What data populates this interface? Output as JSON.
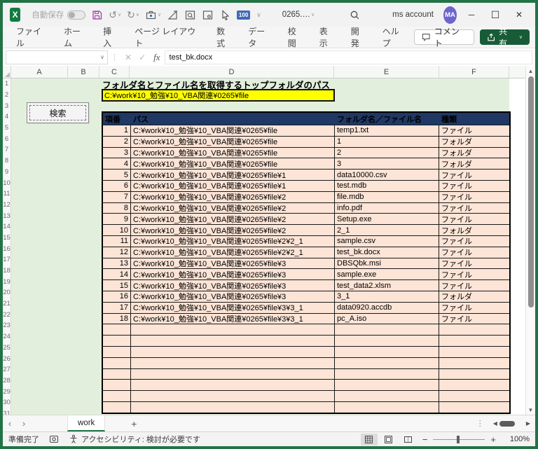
{
  "titlebar": {
    "autosave_label": "自動保存",
    "doc_title": "0265.…",
    "account_label": "ms account",
    "avatar_initials": "MA",
    "hundred_badge": "100"
  },
  "ribbon": {
    "tabs": [
      "ファイル",
      "ホーム",
      "挿入",
      "ページ レイアウト",
      "数式",
      "データ",
      "校閲",
      "表示",
      "開発",
      "ヘルプ"
    ],
    "comment_label": "コメント",
    "share_label": "共有"
  },
  "formula_bar": {
    "name_box": "",
    "fx_label": "fx",
    "content": "test_bk.docx"
  },
  "sheet": {
    "col_headers": [
      "A",
      "B",
      "C",
      "D",
      "E",
      "F"
    ],
    "row_count": 31,
    "title_c1": "フォルダ名とファイル名を取得するトップフォルダのパス",
    "top_folder_path": "C:¥work¥10_勉強¥10_VBA関連¥0265¥file",
    "search_button": "検索",
    "bg_color": "#E2EFDC",
    "highlight_color": "#FFFF00",
    "table": {
      "header_bg": "#1F3864",
      "row_bg": "#FCE4D6",
      "headers": [
        "項番",
        "パス",
        "フォルダ名／ファイル名",
        "種類"
      ],
      "empty_row_count": 8,
      "rows": [
        [
          "1",
          "C:¥work¥10_勉強¥10_VBA関連¥0265¥file",
          "temp1.txt",
          "ファイル"
        ],
        [
          "2",
          "C:¥work¥10_勉強¥10_VBA関連¥0265¥file",
          "1",
          "フォルダ"
        ],
        [
          "3",
          "C:¥work¥10_勉強¥10_VBA関連¥0265¥file",
          "2",
          "フォルダ"
        ],
        [
          "4",
          "C:¥work¥10_勉強¥10_VBA関連¥0265¥file",
          "3",
          "フォルダ"
        ],
        [
          "5",
          "C:¥work¥10_勉強¥10_VBA関連¥0265¥file¥1",
          "data10000.csv",
          "ファイル"
        ],
        [
          "6",
          "C:¥work¥10_勉強¥10_VBA関連¥0265¥file¥1",
          "test.mdb",
          "ファイル"
        ],
        [
          "7",
          "C:¥work¥10_勉強¥10_VBA関連¥0265¥file¥2",
          "file.mdb",
          "ファイル"
        ],
        [
          "8",
          "C:¥work¥10_勉強¥10_VBA関連¥0265¥file¥2",
          "info.pdf",
          "ファイル"
        ],
        [
          "9",
          "C:¥work¥10_勉強¥10_VBA関連¥0265¥file¥2",
          "Setup.exe",
          "ファイル"
        ],
        [
          "10",
          "C:¥work¥10_勉強¥10_VBA関連¥0265¥file¥2",
          "2_1",
          "フォルダ"
        ],
        [
          "11",
          "C:¥work¥10_勉強¥10_VBA関連¥0265¥file¥2¥2_1",
          "sample.csv",
          "ファイル"
        ],
        [
          "12",
          "C:¥work¥10_勉強¥10_VBA関連¥0265¥file¥2¥2_1",
          "test_bk.docx",
          "ファイル"
        ],
        [
          "13",
          "C:¥work¥10_勉強¥10_VBA関連¥0265¥file¥3",
          "DBSQbk.msi",
          "ファイル"
        ],
        [
          "14",
          "C:¥work¥10_勉強¥10_VBA関連¥0265¥file¥3",
          "sample.exe",
          "ファイル"
        ],
        [
          "15",
          "C:¥work¥10_勉強¥10_VBA関連¥0265¥file¥3",
          "test_data2.xlsm",
          "ファイル"
        ],
        [
          "16",
          "C:¥work¥10_勉強¥10_VBA関連¥0265¥file¥3",
          "3_1",
          "フォルダ"
        ],
        [
          "17",
          "C:¥work¥10_勉強¥10_VBA関連¥0265¥file¥3¥3_1",
          "data0920.accdb",
          "ファイル"
        ],
        [
          "18",
          "C:¥work¥10_勉強¥10_VBA関連¥0265¥file¥3¥3_1",
          "pc_A.iso",
          "ファイル"
        ]
      ]
    }
  },
  "tabs_bar": {
    "sheet_tab": "work",
    "add_label": "+"
  },
  "status_bar": {
    "ready": "準備完了",
    "accessibility": "アクセシビリティ: 検討が必要です",
    "zoom": "100%"
  },
  "glyphs": {
    "excel_logo": "X",
    "undo": "↺",
    "redo": "↻",
    "chevron_down": "∨",
    "overflow": "∨",
    "cancel": "✕",
    "enter": "✓",
    "dots_vertical": "⋮",
    "minimize": "─",
    "maximize": "☐",
    "close": "✕",
    "tab_prev": "‹",
    "tab_next": "›",
    "scroll_up": "▲",
    "scroll_down": "▼",
    "scroll_left": "◀",
    "scroll_right": "▶",
    "zoom_minus": "−",
    "zoom_plus": "+"
  }
}
